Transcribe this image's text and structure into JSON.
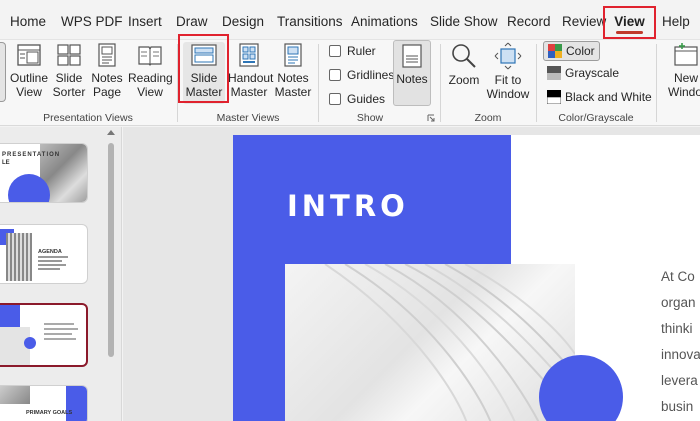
{
  "menu": {
    "tabs": [
      "Home",
      "WPS PDF",
      "Insert",
      "Draw",
      "Design",
      "Transitions",
      "Animations",
      "Slide Show",
      "Record",
      "Review",
      "View",
      "Help"
    ],
    "active": "View"
  },
  "ribbon": {
    "presentation_views": {
      "label": "Presentation Views",
      "buttons": [
        {
          "line1": "Outline",
          "line2": "View"
        },
        {
          "line1": "Slide",
          "line2": "Sorter"
        },
        {
          "line1": "Notes",
          "line2": "Page"
        },
        {
          "line1": "Reading",
          "line2": "View"
        }
      ]
    },
    "master_views": {
      "label": "Master Views",
      "buttons": [
        {
          "line1": "Slide",
          "line2": "Master"
        },
        {
          "line1": "Handout",
          "line2": "Master"
        },
        {
          "line1": "Notes",
          "line2": "Master"
        }
      ]
    },
    "show": {
      "label": "Show",
      "checkboxes": [
        "Ruler",
        "Gridlines",
        "Guides"
      ],
      "notes_label": "Notes"
    },
    "zoom": {
      "label": "Zoom",
      "zoom_label": "Zoom",
      "fit_line1": "Fit to",
      "fit_line2": "Window"
    },
    "color": {
      "label": "Color/Grayscale",
      "options": [
        "Color",
        "Grayscale",
        "Black and White"
      ]
    },
    "window": {
      "new_line1": "New",
      "new_line2": "Windo"
    }
  },
  "thumbnails": {
    "t1_title": "PRESENTATION",
    "t1_sub": "LE",
    "t2_title": "AGENDA",
    "t4_title": "PRIMARY GOALS"
  },
  "slide": {
    "title": "INTRO",
    "lines": [
      "At Co",
      "organ",
      "thinki",
      "innova",
      "levera",
      "busin"
    ]
  },
  "colors": {
    "accent_blue": "#4a5ce8",
    "highlight_red": "#e0222e",
    "selected_thumb_border": "#8b1a2b"
  }
}
